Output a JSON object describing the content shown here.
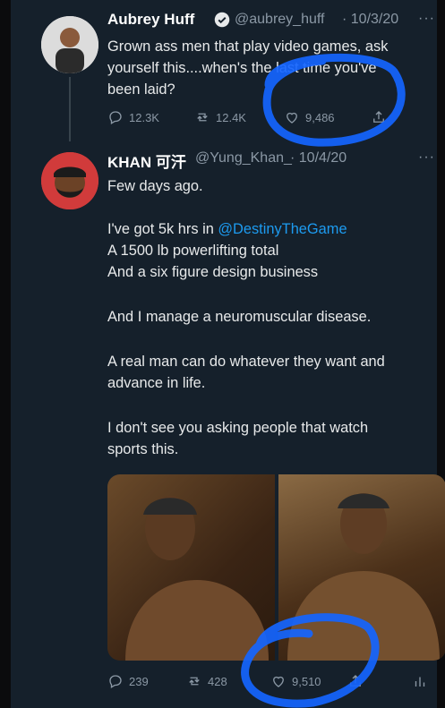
{
  "tweet1": {
    "name": "Aubrey Huff",
    "handle": "@aubrey_huff",
    "date": "· 10/3/20",
    "lines": [
      "Grown ass men that play video games, ask",
      "yourself this....when's the last time you've",
      "been laid?"
    ],
    "replies": "12.3K",
    "retweets": "12.4K",
    "likes": "9,486",
    "more": "···"
  },
  "tweet2": {
    "name": "KHAN 可汗",
    "handle": "@Yung_Khan_",
    "date": "· 10/4/20",
    "line1": "Few days ago.",
    "line2_prefix": "I've got 5k hrs in ",
    "line2_link": "@DestinyTheGame",
    "line3": "A 1500 lb powerlifting total",
    "line4": "And a six figure design business",
    "line5": "And I manage a neuromuscular disease.",
    "line6": "A real man can do whatever they want and",
    "line7": "advance in life.",
    "line8": "I don't see you asking people that watch",
    "line9": "sports this.",
    "replies": "239",
    "retweets": "428",
    "likes": "9,510",
    "more": "···"
  },
  "colors": {
    "background": "#15202b",
    "link": "#1d9bf0",
    "muted": "#8b98a5",
    "annotation": "#1565ff"
  },
  "icons": [
    "verified-badge-icon",
    "reply-icon",
    "retweet-icon",
    "like-icon",
    "share-icon",
    "analytics-icon",
    "more-icon"
  ]
}
